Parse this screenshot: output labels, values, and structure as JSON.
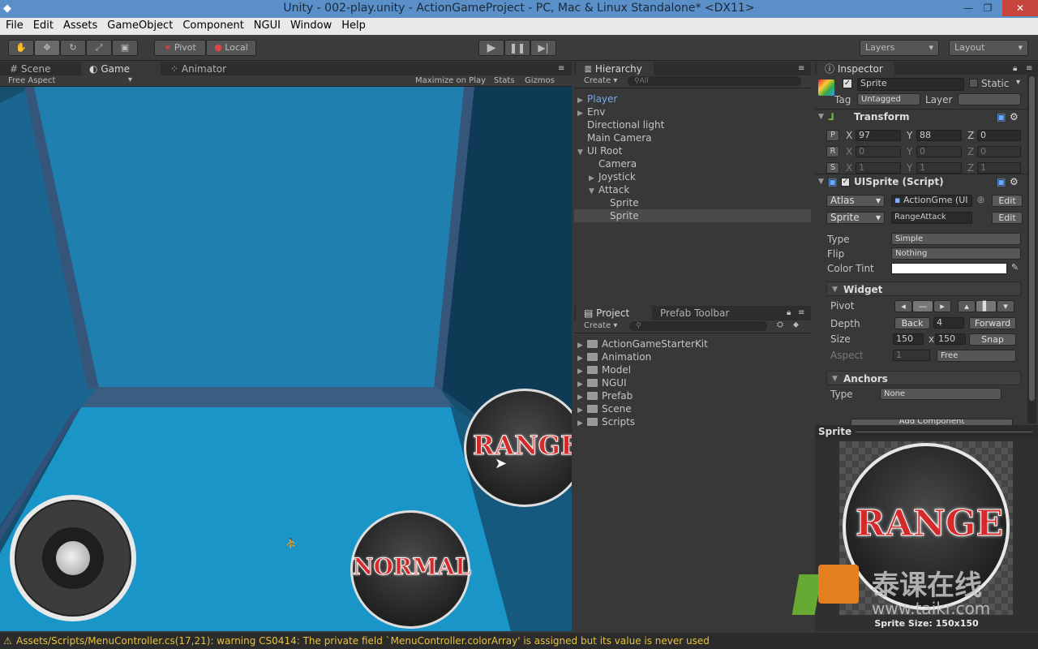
{
  "window": {
    "title": "Unity - 002-play.unity - ActionGameProject - PC, Mac & Linux Standalone* <DX11>"
  },
  "menu": [
    "File",
    "Edit",
    "Assets",
    "GameObject",
    "Component",
    "NGUI",
    "Window",
    "Help"
  ],
  "toolbar": {
    "pivot": "Pivot",
    "local": "Local",
    "layers": "Layers",
    "layout": "Layout"
  },
  "scene_tabs": [
    "Scene",
    "Game",
    "Animator"
  ],
  "game_bar": {
    "aspect": "Free Aspect",
    "maximize": "Maximize on Play",
    "stats": "Stats",
    "gizmos": "Gizmos"
  },
  "game_view": {
    "range_label": "RANGE",
    "normal_label": "NORMAL"
  },
  "hierarchy": {
    "tab": "Hierarchy",
    "create": "Create",
    "search": "All",
    "items": [
      {
        "label": "Player",
        "depth": 0,
        "arrow": "▶",
        "highlight": true
      },
      {
        "label": "Env",
        "depth": 0,
        "arrow": "▶"
      },
      {
        "label": "Directional light",
        "depth": 0,
        "arrow": ""
      },
      {
        "label": "Main Camera",
        "depth": 0,
        "arrow": ""
      },
      {
        "label": "UI Root",
        "depth": 0,
        "arrow": "▼"
      },
      {
        "label": "Camera",
        "depth": 1,
        "arrow": ""
      },
      {
        "label": "Joystick",
        "depth": 1,
        "arrow": "▶"
      },
      {
        "label": "Attack",
        "depth": 1,
        "arrow": "▼"
      },
      {
        "label": "Sprite",
        "depth": 2,
        "arrow": ""
      },
      {
        "label": "Sprite",
        "depth": 2,
        "arrow": "",
        "selected": true
      }
    ]
  },
  "project": {
    "tabs": [
      "Project",
      "Prefab Toolbar"
    ],
    "create": "Create",
    "folders": [
      "ActionGameStarterKit",
      "Animation",
      "Model",
      "NGUI",
      "Prefab",
      "Scene",
      "Scripts"
    ]
  },
  "inspector": {
    "tab": "Inspector",
    "object_name": "Sprite",
    "static_label": "Static",
    "tag_label": "Tag",
    "tag_value": "Untagged",
    "layer_label": "Layer",
    "transform": {
      "title": "Transform",
      "p": "P",
      "r": "R",
      "s": "S",
      "x": "X",
      "y": "Y",
      "z": "Z",
      "pos": [
        "97",
        "88",
        "0"
      ],
      "rot": [
        "0",
        "0",
        "0"
      ],
      "scale": [
        "1",
        "1",
        "1"
      ]
    },
    "uisprite": {
      "title": "UISprite (Script)",
      "atlas_label": "Atlas",
      "atlas_value": "ActionGme (UI",
      "sprite_label": "Sprite",
      "sprite_value": "RangeAttack",
      "edit": "Edit",
      "type_label": "Type",
      "type_value": "Simple",
      "flip_label": "Flip",
      "flip_value": "Nothing",
      "tint_label": "Color Tint"
    },
    "widget": {
      "title": "Widget",
      "pivot_label": "Pivot",
      "depth_label": "Depth",
      "back": "Back",
      "depth_value": "4",
      "forward": "Forward",
      "size_label": "Size",
      "w": "150",
      "times": "x",
      "h": "150",
      "snap": "Snap",
      "aspect_label": "Aspect",
      "aspect_value": "1",
      "aspect_mode": "Free"
    },
    "anchors": {
      "title": "Anchors",
      "type_label": "Type",
      "type_value": "None"
    },
    "add_component": "Add Component"
  },
  "preview": {
    "title": "Sprite",
    "label": "RANGE",
    "size_text": "Sprite Size: 150x150",
    "watermark": "泰课在线",
    "watermark_url": "www.taikr.com"
  },
  "status": {
    "message": "Assets/Scripts/MenuController.cs(17,21): warning CS0414: The private field `MenuController.colorArray' is assigned but its value is never used"
  },
  "colors": {
    "accent": "#5b8fc7",
    "warning": "#e7c23b",
    "floor": "#1a95c8",
    "wall": "#1d5d80"
  }
}
